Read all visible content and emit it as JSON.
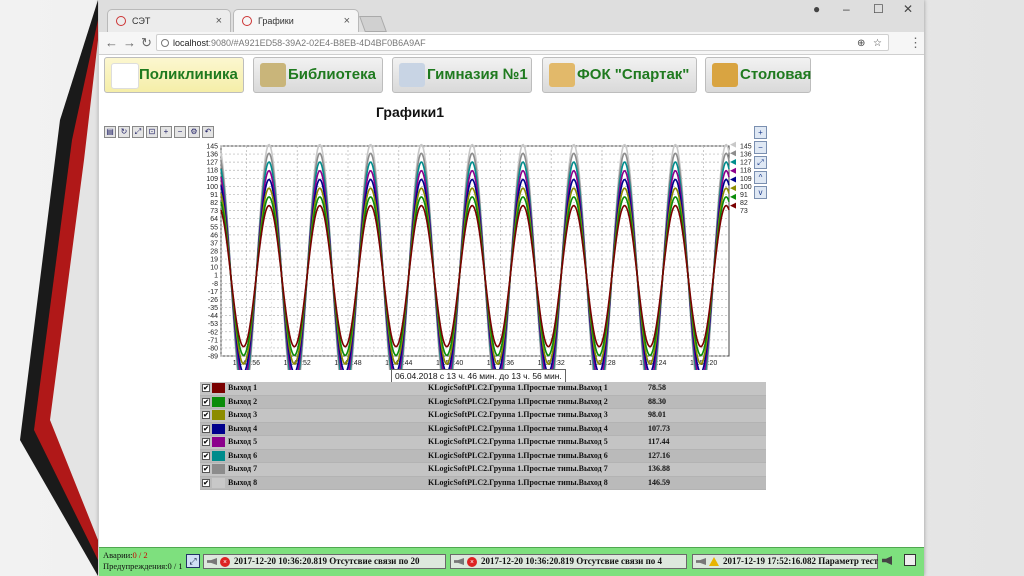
{
  "browser": {
    "tabs": [
      {
        "label": "СЭТ",
        "close": "×"
      },
      {
        "label": "Графики",
        "close": "×"
      }
    ],
    "url_host": "localhost",
    "url_rest": ":9080/#A921ED58-39A2-02E4-B8EB-4D4BF0B6A9AF",
    "window_controls": {
      "minimize": "–",
      "maximize": "☐",
      "close": "✕"
    }
  },
  "nav": [
    {
      "label": "Поликлиника",
      "icon": "clinic-icon"
    },
    {
      "label": "Библиотека",
      "icon": "book-icon"
    },
    {
      "label": "Гимназия №1",
      "icon": "compass-icon"
    },
    {
      "label": "ФОК \"Спартак\"",
      "icon": "palette-icon"
    },
    {
      "label": "Столовая",
      "icon": "burger-icon"
    }
  ],
  "page_title": "Графики1",
  "chart_data": {
    "type": "line",
    "y_ticks": [
      "145",
      "136",
      "127",
      "118",
      "109",
      "100",
      "91",
      "82",
      "73",
      "64",
      "55",
      "46",
      "37",
      "28",
      "19",
      "10",
      "1",
      "-8",
      "-17",
      "-26",
      "-35",
      "-44",
      "-53",
      "-62",
      "-71",
      "-80",
      "-89"
    ],
    "right_ticks": [
      "145",
      "136",
      "127",
      "118",
      "109",
      "100",
      "91",
      "82",
      "73"
    ],
    "x_ticks": [
      "13:46:56",
      "13:47:52",
      "13:48:48",
      "13:49:44",
      "13:50:40",
      "13:51:36",
      "13:52:32",
      "13:53:28",
      "13:54:24",
      "13:55:20"
    ],
    "ylim": [
      -89,
      145
    ],
    "grid": true,
    "cycles": 10,
    "series": [
      {
        "name": "Выход 1",
        "color": "#7a0000",
        "amplitude": 78.58
      },
      {
        "name": "Выход 2",
        "color": "#0a8c0a",
        "amplitude": 88.3
      },
      {
        "name": "Выход 3",
        "color": "#8c8c00",
        "amplitude": 98.01
      },
      {
        "name": "Выход 4",
        "color": "#00008c",
        "amplitude": 107.73
      },
      {
        "name": "Выход 5",
        "color": "#8c008c",
        "amplitude": 117.44
      },
      {
        "name": "Выход 6",
        "color": "#008c8c",
        "amplitude": 127.16
      },
      {
        "name": "Выход 7",
        "color": "#8c8c8c",
        "amplitude": 136.88
      },
      {
        "name": "Выход 8",
        "color": "#c8c8c8",
        "amplitude": 146.59
      }
    ]
  },
  "date_range": "06.04.2018 с 13 ч. 46 мин. до 13 ч. 56 мин.",
  "legend": [
    {
      "name": "Выход 1",
      "source": "KLogicSoftPLC2.Группа 1.Простые типы.Выход 1",
      "value": "78.58",
      "color": "#7a0000"
    },
    {
      "name": "Выход 2",
      "source": "KLogicSoftPLC2.Группа 1.Простые типы.Выход 2",
      "value": "88.30",
      "color": "#0a8c0a"
    },
    {
      "name": "Выход 3",
      "source": "KLogicSoftPLC2.Группа 1.Простые типы.Выход 3",
      "value": "98.01",
      "color": "#8c8c00"
    },
    {
      "name": "Выход 4",
      "source": "KLogicSoftPLC2.Группа 1.Простые типы.Выход 4",
      "value": "107.73",
      "color": "#00008c"
    },
    {
      "name": "Выход 5",
      "source": "KLogicSoftPLC2.Группа 1.Простые типы.Выход 5",
      "value": "117.44",
      "color": "#8c008c"
    },
    {
      "name": "Выход 6",
      "source": "KLogicSoftPLC2.Группа 1.Простые типы.Выход 6",
      "value": "127.16",
      "color": "#008c8c"
    },
    {
      "name": "Выход 7",
      "source": "KLogicSoftPLC2.Группа 1.Простые типы.Выход 7",
      "value": "136.88",
      "color": "#8c8c8c"
    },
    {
      "name": "Выход 8",
      "source": "KLogicSoftPLC2.Группа 1.Простые типы.Выход 8",
      "value": "146.59",
      "color": "#c8c8c8"
    }
  ],
  "status": {
    "alarms_label": "Аварии:",
    "alarms_value": "0 / 2",
    "warnings_label": "Предупреждения:",
    "warnings_value": "0 / 1",
    "messages": [
      {
        "text": "2017-12-20 10:36:20.819 Отсутсвие связи по 20",
        "kind": "error"
      },
      {
        "text": "2017-12-20 10:36:20.819 Отсутсвие связи по 4",
        "kind": "error"
      },
      {
        "text": "2017-12-19 17:52:16.082 Параметр тест",
        "kind": "warning"
      }
    ]
  }
}
